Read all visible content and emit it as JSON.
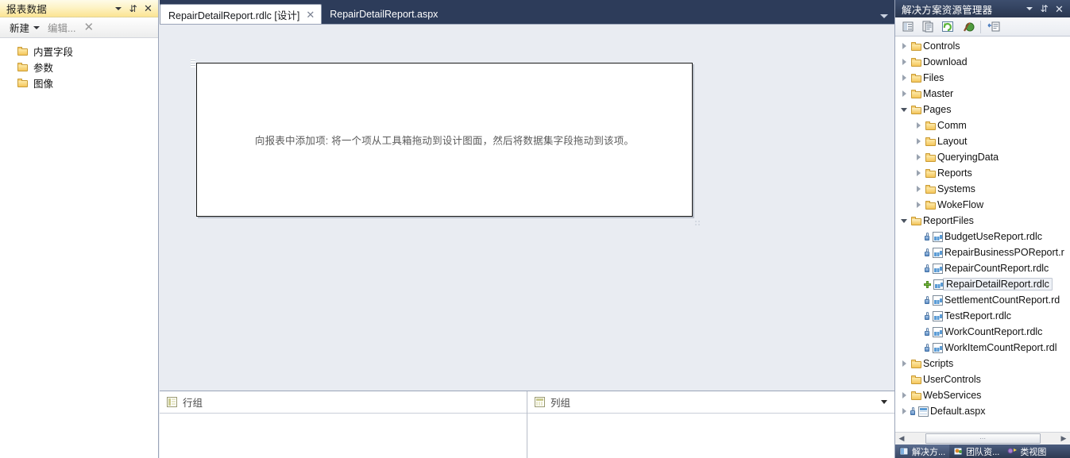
{
  "report_data_panel": {
    "title": "报表数据",
    "title_buttons": [
      {
        "name": "dropdown-icon",
        "glyph": "▾"
      },
      {
        "name": "pin-icon",
        "glyph": "⇵"
      },
      {
        "name": "close-icon",
        "glyph": "✕"
      }
    ],
    "toolbar": {
      "new_label": "新建",
      "edit_label": "编辑...",
      "delete_glyph": "✕"
    },
    "tree": [
      {
        "label": "内置字段",
        "icon": "folder-icon"
      },
      {
        "label": "参数",
        "icon": "folder-icon"
      },
      {
        "label": "图像",
        "icon": "folder-icon"
      }
    ]
  },
  "editor": {
    "tabs": [
      {
        "label": "RepairDetailReport.rdlc [设计]",
        "active": true,
        "close_glyph": "✕"
      },
      {
        "label": "RepairDetailReport.aspx",
        "active": false,
        "close_glyph": ""
      }
    ],
    "tabstrip_dropdown": "▾",
    "design_surface": {
      "hint_text": "向报表中添加项: 将一个项从工具箱拖动到设计图面，然后将数据集字段拖动到该项。"
    },
    "groups_panel": {
      "row_groups_label": "行组",
      "column_groups_label": "列组",
      "dropdown_glyph": "▾"
    }
  },
  "solution_explorer": {
    "title": "解决方案资源管理器",
    "title_buttons": [
      {
        "name": "dropdown-icon",
        "glyph": "▾"
      },
      {
        "name": "pin-icon",
        "glyph": "⇵"
      },
      {
        "name": "close-icon",
        "glyph": "✕"
      }
    ],
    "toolbar_icons": [
      "properties-icon",
      "show-all-files-icon",
      "refresh-icon",
      "view-designer-icon",
      "view-code-icon"
    ],
    "tree": [
      {
        "label": "Controls",
        "indent": 0,
        "twisty": "closed",
        "icon": "folder-icon"
      },
      {
        "label": "Download",
        "indent": 0,
        "twisty": "closed",
        "icon": "folder-icon"
      },
      {
        "label": "Files",
        "indent": 0,
        "twisty": "closed",
        "icon": "folder-icon"
      },
      {
        "label": "Master",
        "indent": 0,
        "twisty": "closed",
        "icon": "folder-icon"
      },
      {
        "label": "Pages",
        "indent": 0,
        "twisty": "open",
        "icon": "folder-open-icon"
      },
      {
        "label": "Comm",
        "indent": 1,
        "twisty": "closed",
        "icon": "folder-icon"
      },
      {
        "label": "Layout",
        "indent": 1,
        "twisty": "closed",
        "icon": "folder-icon"
      },
      {
        "label": "QueryingData",
        "indent": 1,
        "twisty": "closed",
        "icon": "folder-icon"
      },
      {
        "label": "Reports",
        "indent": 1,
        "twisty": "closed",
        "icon": "folder-icon"
      },
      {
        "label": "Systems",
        "indent": 1,
        "twisty": "closed",
        "icon": "folder-icon"
      },
      {
        "label": "WokeFlow",
        "indent": 1,
        "twisty": "closed",
        "icon": "folder-icon"
      },
      {
        "label": "ReportFiles",
        "indent": 0,
        "twisty": "open",
        "icon": "folder-open-icon"
      },
      {
        "label": "BudgetUseReport.rdlc",
        "indent": 1,
        "twisty": "none",
        "icon": "rdlc-file-icon",
        "badge": "lock"
      },
      {
        "label": "RepairBusinessPOReport.r",
        "indent": 1,
        "twisty": "none",
        "icon": "rdlc-file-icon",
        "badge": "lock"
      },
      {
        "label": "RepairCountReport.rdlc",
        "indent": 1,
        "twisty": "none",
        "icon": "rdlc-file-icon",
        "badge": "lock"
      },
      {
        "label": "RepairDetailReport.rdlc",
        "indent": 1,
        "twisty": "none",
        "icon": "rdlc-file-icon",
        "badge": "plus",
        "selected": true
      },
      {
        "label": "SettlementCountReport.rd",
        "indent": 1,
        "twisty": "none",
        "icon": "rdlc-file-icon",
        "badge": "lock"
      },
      {
        "label": "TestReport.rdlc",
        "indent": 1,
        "twisty": "none",
        "icon": "rdlc-file-icon",
        "badge": "lock"
      },
      {
        "label": "WorkCountReport.rdlc",
        "indent": 1,
        "twisty": "none",
        "icon": "rdlc-file-icon",
        "badge": "lock"
      },
      {
        "label": "WorkItemCountReport.rdl",
        "indent": 1,
        "twisty": "none",
        "icon": "rdlc-file-icon",
        "badge": "lock"
      },
      {
        "label": "Scripts",
        "indent": 0,
        "twisty": "closed",
        "icon": "folder-icon"
      },
      {
        "label": "UserControls",
        "indent": 0,
        "twisty": "none",
        "icon": "folder-icon"
      },
      {
        "label": "WebServices",
        "indent": 0,
        "twisty": "closed",
        "icon": "folder-icon"
      },
      {
        "label": "Default.aspx",
        "indent": 0,
        "twisty": "closed",
        "icon": "aspx-file-icon",
        "badge": "lock"
      }
    ],
    "hscrollbar": {
      "left_arrow": "◀",
      "right_arrow": "▶",
      "thumb_grip": "⋯"
    },
    "bottom_tabs": [
      {
        "label": "解决方...",
        "active": true,
        "icon": "solution-explorer-icon"
      },
      {
        "label": "团队资...",
        "active": false,
        "icon": "team-explorer-icon"
      },
      {
        "label": "类视图",
        "active": false,
        "icon": "class-view-icon"
      }
    ]
  },
  "colors": {
    "tabstrip_bg": "#2d3c5a",
    "panel_title_yellow": "#fce493",
    "solution_title_blue": "#33425f",
    "workspace_bg": "#e9ecf2",
    "folder_gold": "#f6c75c"
  }
}
